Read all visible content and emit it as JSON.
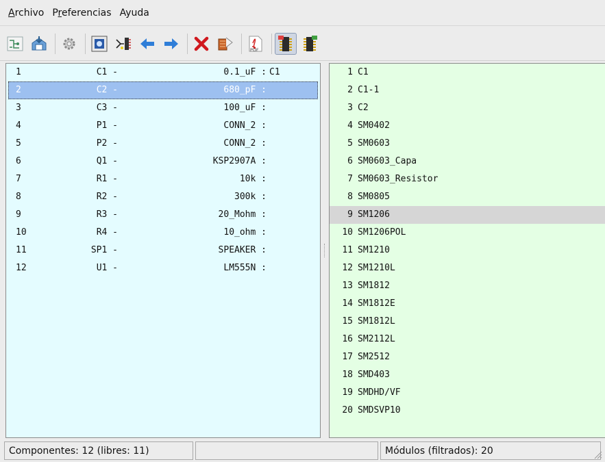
{
  "menu": [
    {
      "mnemonic": "A",
      "rest": "rchivo"
    },
    {
      "pre": "P",
      "mnemonic": "r",
      "rest": "eferencias"
    },
    {
      "mnemonic": "",
      "rest": "Ayuda"
    }
  ],
  "toolbar": {
    "icons": [
      "schematic-icon",
      "save-netlist-icon",
      "gear-icon",
      "view-footprint-icon",
      "auto-associate-icon",
      "arrow-left-icon",
      "arrow-right-icon",
      "delete-associations-icon",
      "export-icon",
      "pdf-icon",
      "filter-by-component-icon",
      "filter-by-pins-icon"
    ]
  },
  "components": [
    {
      "idx": "1",
      "ref": "C1 -",
      "value": "0.1_uF :",
      "footprint": "C1"
    },
    {
      "idx": "2",
      "ref": "C2 -",
      "value": "680_pF :",
      "footprint": ""
    },
    {
      "idx": "3",
      "ref": "C3 -",
      "value": "100_uF :",
      "footprint": ""
    },
    {
      "idx": "4",
      "ref": "P1 -",
      "value": "CONN_2 :",
      "footprint": ""
    },
    {
      "idx": "5",
      "ref": "P2 -",
      "value": "CONN_2 :",
      "footprint": ""
    },
    {
      "idx": "6",
      "ref": "Q1 -",
      "value": "KSP2907A :",
      "footprint": ""
    },
    {
      "idx": "7",
      "ref": "R1 -",
      "value": "10k :",
      "footprint": ""
    },
    {
      "idx": "8",
      "ref": "R2 -",
      "value": "300k :",
      "footprint": ""
    },
    {
      "idx": "9",
      "ref": "R3 -",
      "value": "20_Mohm :",
      "footprint": ""
    },
    {
      "idx": "10",
      "ref": "R4 -",
      "value": "10_ohm :",
      "footprint": ""
    },
    {
      "idx": "11",
      "ref": "SP1 -",
      "value": "SPEAKER :",
      "footprint": ""
    },
    {
      "idx": "12",
      "ref": "U1 -",
      "value": "LM555N :",
      "footprint": ""
    }
  ],
  "selected_component": 1,
  "modules": [
    {
      "idx": "1",
      "name": "C1"
    },
    {
      "idx": "2",
      "name": "C1-1"
    },
    {
      "idx": "3",
      "name": "C2"
    },
    {
      "idx": "4",
      "name": "SM0402"
    },
    {
      "idx": "5",
      "name": "SM0603"
    },
    {
      "idx": "6",
      "name": "SM0603_Capa"
    },
    {
      "idx": "7",
      "name": "SM0603_Resistor"
    },
    {
      "idx": "8",
      "name": "SM0805"
    },
    {
      "idx": "9",
      "name": "SM1206"
    },
    {
      "idx": "10",
      "name": "SM1206POL"
    },
    {
      "idx": "11",
      "name": "SM1210"
    },
    {
      "idx": "12",
      "name": "SM1210L"
    },
    {
      "idx": "13",
      "name": "SM1812"
    },
    {
      "idx": "14",
      "name": "SM1812E"
    },
    {
      "idx": "15",
      "name": "SM1812L"
    },
    {
      "idx": "16",
      "name": "SM2112L"
    },
    {
      "idx": "17",
      "name": "SM2512"
    },
    {
      "idx": "18",
      "name": "SMD403"
    },
    {
      "idx": "19",
      "name": "SMDHD/VF"
    },
    {
      "idx": "20",
      "name": "SMDSVP10"
    }
  ],
  "highlighted_module": 8,
  "status": {
    "components": "Componentes: 12 (libres: 11)",
    "middle": "",
    "modules": "Módulos (filtrados): 20"
  },
  "colors": {
    "components_bg": "#e4fcff",
    "modules_bg": "#e4ffe4",
    "selection": "#9dc0f0",
    "module_highlight": "#d6d6d6"
  }
}
